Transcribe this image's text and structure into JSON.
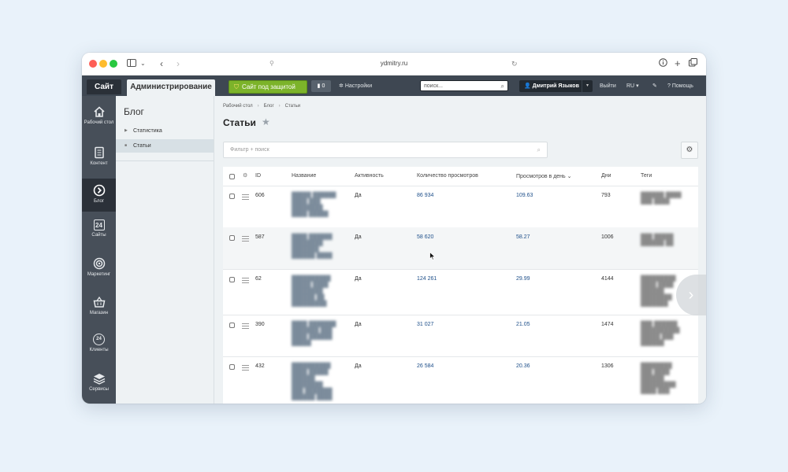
{
  "browser": {
    "url": "ydmitry.ru"
  },
  "topbar": {
    "site_label": "Сайт",
    "admin_label": "Администрирование",
    "protect_label": "Сайт под защитой",
    "notifications_count": "0",
    "settings_label": "Настройки",
    "search_placeholder": "поиск...",
    "user_name": "Дмитрий Языков",
    "logout_label": "Выйти",
    "lang_label": "RU",
    "help_label": "Помощь"
  },
  "left_nav": {
    "items": [
      {
        "label": "Рабочий стол",
        "icon": "home-icon"
      },
      {
        "label": "Контент",
        "icon": "document-icon"
      },
      {
        "label": "Блог",
        "icon": "arrow-circle-icon"
      },
      {
        "label": "Сайты",
        "icon": "calendar-icon"
      },
      {
        "label": "Маркетинг",
        "icon": "target-icon"
      },
      {
        "label": "Магазин",
        "icon": "basket-icon"
      },
      {
        "label": "Клиенты",
        "icon": "clock-24-icon"
      },
      {
        "label": "Сервисы",
        "icon": "layers-icon"
      }
    ],
    "calendar_day": "24",
    "clock_label": "24"
  },
  "sub_nav": {
    "title": "Блог",
    "items": [
      {
        "label": "Статистика"
      },
      {
        "label": "Статьи"
      }
    ]
  },
  "main": {
    "breadcrumbs": [
      "Рабочий стол",
      "Блог",
      "Статьи"
    ],
    "title": "Статьи",
    "filter_placeholder": "Фильтр + поиск"
  },
  "table": {
    "columns": [
      "ID",
      "Название",
      "Активность",
      "Количество просмотров",
      "Просмотров в день",
      "Дни",
      "Теги"
    ],
    "rows": [
      {
        "id": "606",
        "active": "Да",
        "views": "86 934",
        "per_day": "109.63",
        "days": "793"
      },
      {
        "id": "587",
        "active": "Да",
        "views": "58 620",
        "per_day": "58.27",
        "days": "1006"
      },
      {
        "id": "62",
        "active": "Да",
        "views": "124 261",
        "per_day": "29.99",
        "days": "4144"
      },
      {
        "id": "390",
        "active": "Да",
        "views": "31 027",
        "per_day": "21.05",
        "days": "1474"
      },
      {
        "id": "432",
        "active": "Да",
        "views": "26 584",
        "per_day": "20.36",
        "days": "1306"
      }
    ]
  }
}
